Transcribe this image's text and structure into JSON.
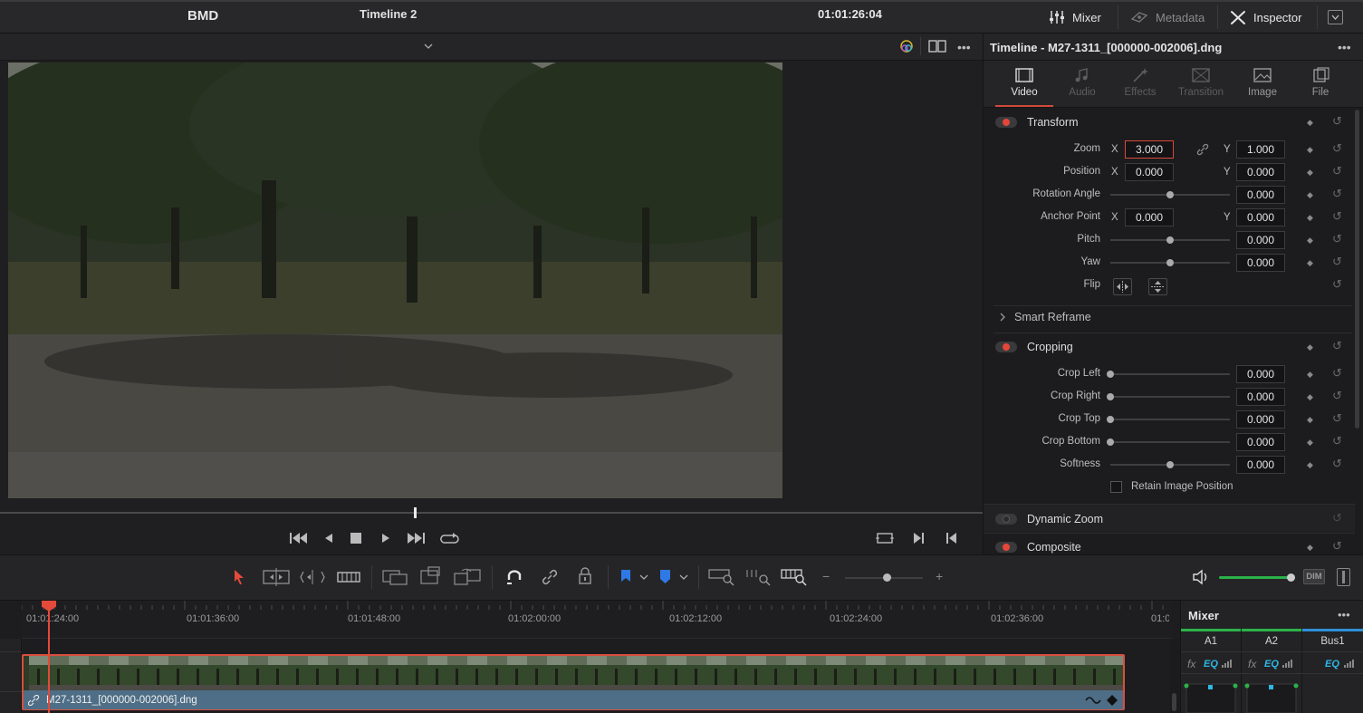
{
  "app": {
    "title": "BMD"
  },
  "topbar": {
    "mixer_label": "Mixer",
    "metadata_label": "Metadata",
    "inspector_label": "Inspector"
  },
  "viewer": {
    "timeline_name": "Timeline 2",
    "timecode": "01:01:26:04"
  },
  "inspector": {
    "title": "Timeline - M27-1311_[000000-002006].dng",
    "tabs": [
      {
        "label": "Video",
        "active": true
      },
      {
        "label": "Audio",
        "active": false
      },
      {
        "label": "Effects",
        "active": false
      },
      {
        "label": "Transition",
        "active": false
      },
      {
        "label": "Image",
        "active": false
      },
      {
        "label": "File",
        "active": false
      }
    ],
    "transform": {
      "title": "Transform",
      "zoom_label": "Zoom",
      "zoom_x": "3.000",
      "zoom_y": "1.000",
      "position_label": "Position",
      "position_x": "0.000",
      "position_y": "0.000",
      "rotation_label": "Rotation Angle",
      "rotation": "0.000",
      "anchor_label": "Anchor Point",
      "anchor_x": "0.000",
      "anchor_y": "0.000",
      "pitch_label": "Pitch",
      "pitch": "0.000",
      "yaw_label": "Yaw",
      "yaw": "0.000",
      "flip_label": "Flip",
      "x": "X",
      "y": "Y"
    },
    "smart_reframe": "Smart Reframe",
    "cropping": {
      "title": "Cropping",
      "left_label": "Crop Left",
      "left": "0.000",
      "right_label": "Crop Right",
      "right": "0.000",
      "top_label": "Crop Top",
      "top": "0.000",
      "bottom_label": "Crop Bottom",
      "bottom": "0.000",
      "softness_label": "Softness",
      "softness": "0.000",
      "retain_label": "Retain Image Position"
    },
    "dynamic_zoom": "Dynamic Zoom",
    "composite": "Composite"
  },
  "timeline": {
    "ruler": [
      "01:01:24:00",
      "01:01:36:00",
      "01:01:48:00",
      "01:02:00:00",
      "01:02:12:00",
      "01:02:24:00",
      "01:02:36:00",
      "01:0"
    ],
    "clip_name": "M27-1311_[000000-002006].dng"
  },
  "toolbar": {
    "dim_label": "DIM"
  },
  "mixer": {
    "title": "Mixer",
    "channels": [
      "A1",
      "A2",
      "Bus1"
    ],
    "fx": "fx",
    "eq": "EQ"
  },
  "colors": {
    "accent": "#e34a3a",
    "clip": "#4d6e86",
    "volume": "#2bb24a"
  }
}
